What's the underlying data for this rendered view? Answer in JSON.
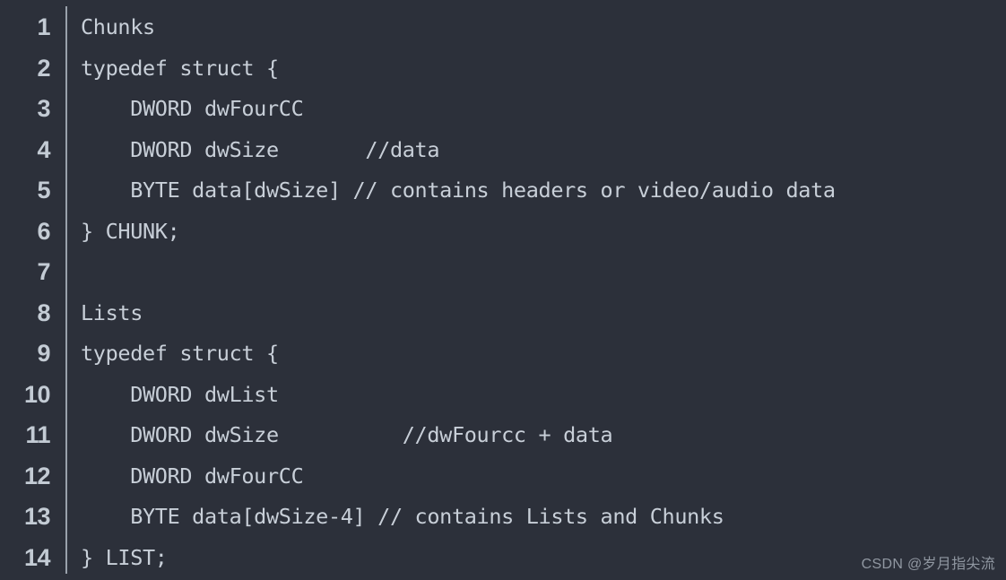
{
  "editor": {
    "background_color": "#2c303a",
    "text_color": "#c8cfd8",
    "gutter_text_color": "#c3cbd4",
    "gutter_separator_color": "#9aa1ab",
    "line_count": 14,
    "lines": [
      {
        "number": "1",
        "text": "Chunks"
      },
      {
        "number": "2",
        "text": "typedef struct {"
      },
      {
        "number": "3",
        "text": "    DWORD dwFourCC"
      },
      {
        "number": "4",
        "text": "    DWORD dwSize       //data"
      },
      {
        "number": "5",
        "text": "    BYTE data[dwSize] // contains headers or video/audio data"
      },
      {
        "number": "6",
        "text": "} CHUNK;"
      },
      {
        "number": "7",
        "text": ""
      },
      {
        "number": "8",
        "text": "Lists"
      },
      {
        "number": "9",
        "text": "typedef struct {"
      },
      {
        "number": "10",
        "text": "    DWORD dwList"
      },
      {
        "number": "11",
        "text": "    DWORD dwSize          //dwFourcc + data"
      },
      {
        "number": "12",
        "text": "    DWORD dwFourCC"
      },
      {
        "number": "13",
        "text": "    BYTE data[dwSize-4] // contains Lists and Chunks"
      },
      {
        "number": "14",
        "text": "} LIST;"
      }
    ]
  },
  "watermark": {
    "text": "CSDN @岁月指尖流",
    "color": "#9097a1"
  }
}
